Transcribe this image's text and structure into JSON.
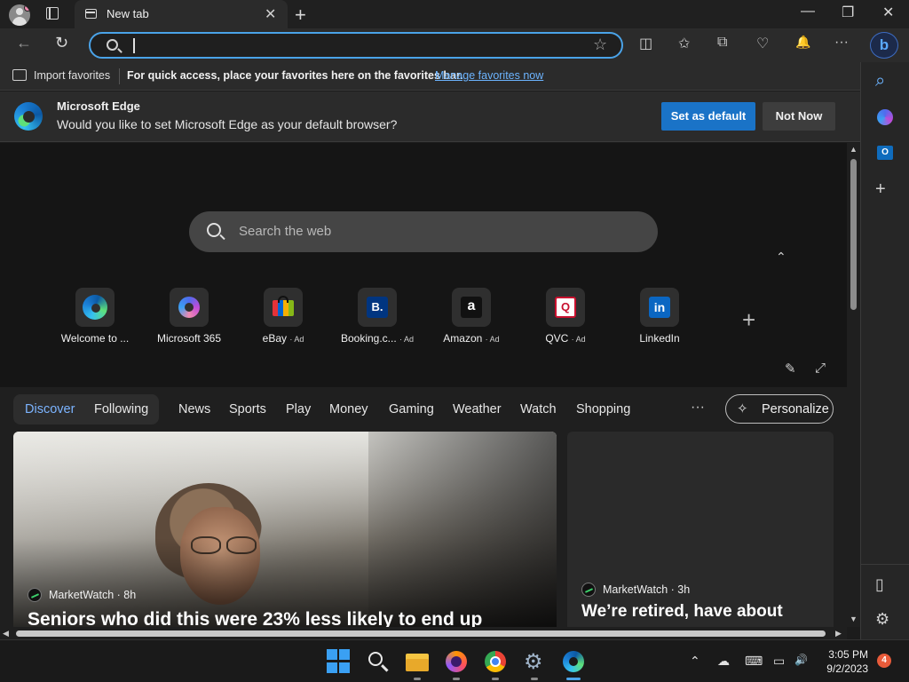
{
  "browser": {
    "tab_title": "New tab",
    "tab_close": "✕",
    "new_tab": "+",
    "window_controls": {
      "minimize": "—",
      "restore": "❐",
      "close": "✕"
    },
    "nav": {
      "back": "←",
      "refresh": "↻"
    },
    "address_value": "",
    "star": "☆",
    "toolbar_icons": [
      "split-screen-icon",
      "favorites-icon",
      "collections-icon",
      "browser-essentials-icon",
      "notifications-icon",
      "more-icon"
    ],
    "toolbar_glyphs": {
      "split": "◫",
      "favorites": "✩",
      "collections": "⧉",
      "essentials": "♡",
      "notifications": "🔔",
      "more": "···"
    },
    "bing_label": "b"
  },
  "favorites_bar": {
    "import_label": "Import favorites",
    "hint": "For quick access, place your favorites here on the favorites bar.",
    "manage_link": "Manage favorites now"
  },
  "notification": {
    "title": "Microsoft Edge",
    "message": "Would you like to set Microsoft Edge as your default browser?",
    "primary_button": "Set as default",
    "secondary_button": "Not Now"
  },
  "newtab": {
    "search_placeholder": "Search the web",
    "collapse_arrow": "⌃",
    "add_tile": "+",
    "tools": {
      "edit": "✎",
      "expand": "⤢"
    },
    "quick_links": [
      {
        "label": "Welcome to ...",
        "ad": "",
        "icon": "edge-icon"
      },
      {
        "label": "Microsoft 365",
        "ad": "",
        "icon": "microsoft-365-icon"
      },
      {
        "label": "eBay",
        "ad": "· Ad",
        "icon": "ebay-icon"
      },
      {
        "label": "Booking.c...",
        "ad": "· Ad",
        "icon": "booking-icon"
      },
      {
        "label": "Amazon",
        "ad": "· Ad",
        "icon": "amazon-icon"
      },
      {
        "label": "QVC",
        "ad": "· Ad",
        "icon": "qvc-icon"
      },
      {
        "label": "LinkedIn",
        "ad": "",
        "icon": "linkedin-icon"
      }
    ],
    "tile_glyphs": {
      "booking": "B.",
      "amazon": "a",
      "qvc": "Q",
      "linkedin": "in"
    }
  },
  "feed": {
    "tabs": [
      "Discover",
      "Following",
      "News",
      "Sports",
      "Play",
      "Money",
      "Gaming",
      "Weather",
      "Watch",
      "Shopping"
    ],
    "active_tab": "Discover",
    "more": "···",
    "personalize": "Personalize",
    "main_card": {
      "source": "MarketWatch · 8h",
      "headline": "Seniors who did this were 23% less likely to end up"
    },
    "side_card": {
      "source": "MarketWatch · 3h",
      "headline": "We’re retired, have about"
    }
  },
  "sidebar": {
    "icons": [
      "search-icon",
      "copilot-icon",
      "outlook-icon",
      "add-icon",
      "sidebar-toggle-icon",
      "settings-icon"
    ],
    "glyphs": {
      "search": "⌕",
      "add": "+",
      "panel": "▯",
      "settings": "⚙"
    }
  },
  "taskbar": {
    "apps": [
      "windows-start-icon",
      "search-icon",
      "file-explorer-icon",
      "firefox-icon",
      "chrome-icon",
      "settings-icon",
      "edge-icon"
    ],
    "tray_glyphs": {
      "chevron": "⌃",
      "onedrive": "☁",
      "keyboard": "⌨",
      "display": "▭",
      "volume": "🔊"
    },
    "time": "3:05 PM",
    "date": "9/2/2023",
    "notification_count": "4"
  },
  "colors": {
    "accent": "#4aa3e8",
    "primary_button": "#1a73c7",
    "active_feed_tab": "#7cb4ff",
    "link": "#6cb4ff"
  }
}
